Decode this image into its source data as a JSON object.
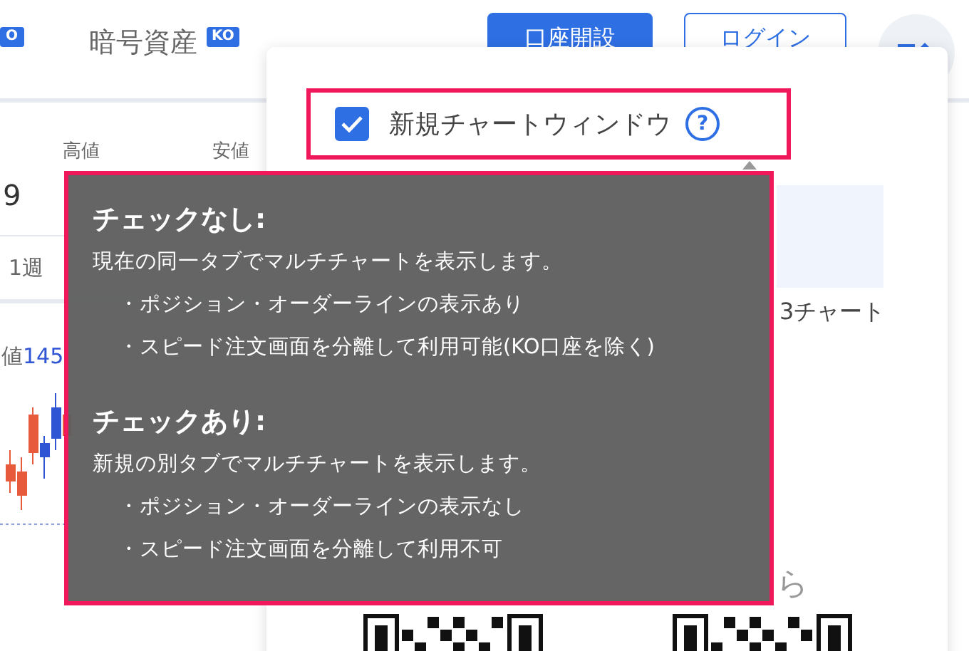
{
  "header": {
    "cut_badge": "O",
    "nav_label": "暗号資産",
    "nav_badge": "KO",
    "buttons": [
      {
        "label": "口座開設",
        "kind": "primary"
      },
      {
        "label": "ログイン",
        "kind": "outline"
      }
    ]
  },
  "market": {
    "stat_labels": [
      "高値",
      "安値"
    ],
    "price_fragment": "9",
    "period": "1週",
    "close_label": "値",
    "close_value": "145"
  },
  "popup": {
    "option": {
      "label": "新規チャートウィンドウ",
      "checked": true,
      "help": "?"
    },
    "layout_option": "3チャート",
    "download_fragment": "ら"
  },
  "tooltip": {
    "sections": [
      {
        "title": "チェックなし:",
        "description": "現在の同一タブでマルチチャートを表示します。",
        "points": [
          "・ポジション・オーダーラインの表示あり",
          "・スピード注文画面を分離して利用可能(KO口座を除く)"
        ]
      },
      {
        "title": "チェックあり:",
        "description": "新規の別タブでマルチチャートを表示します。",
        "points": [
          "・ポジション・オーダーラインの表示なし",
          "・スピード注文画面を分離して利用不可"
        ]
      }
    ]
  }
}
